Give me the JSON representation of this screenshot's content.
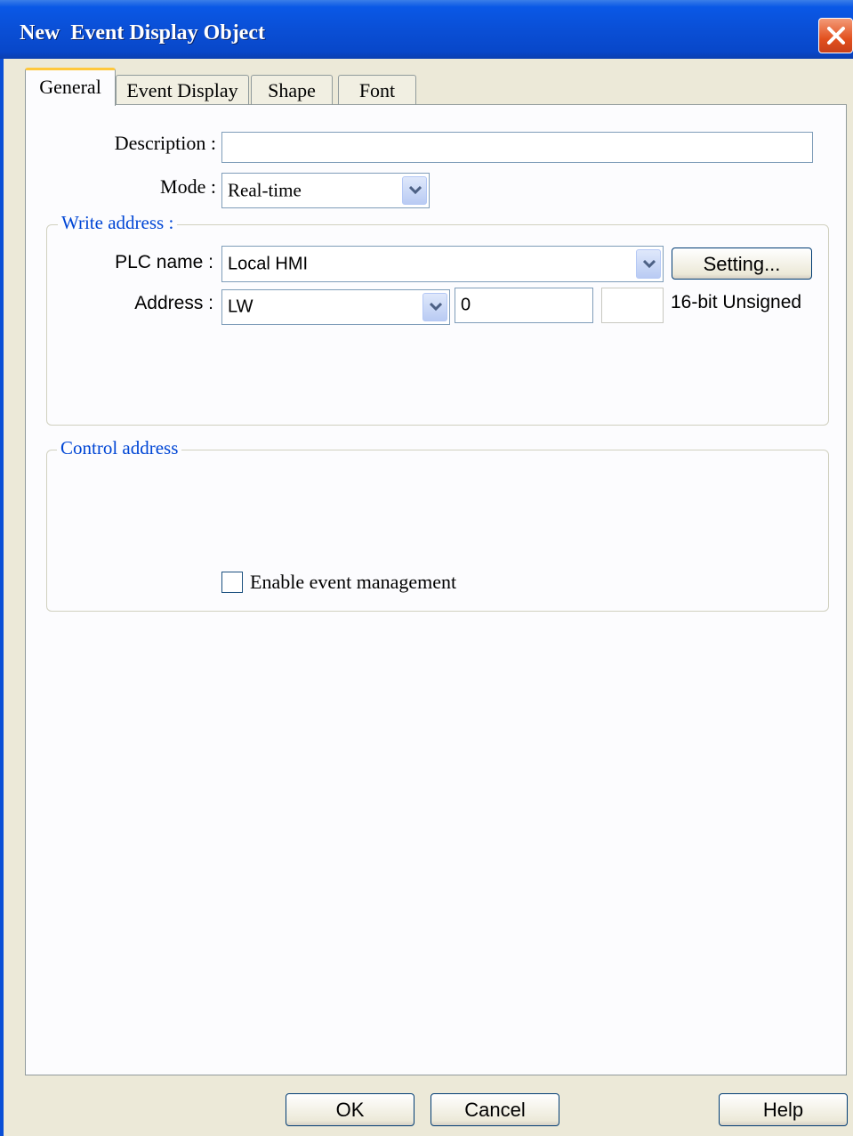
{
  "window": {
    "title": "New  Event Display Object"
  },
  "tabs": [
    {
      "label": "General",
      "active": true
    },
    {
      "label": "Event Display",
      "active": false
    },
    {
      "label": "Shape",
      "active": false
    },
    {
      "label": "Font",
      "active": false
    }
  ],
  "general": {
    "description_label": "Description :",
    "description_value": "",
    "mode_label": "Mode :",
    "mode_value": "Real-time"
  },
  "write_address": {
    "legend": "Write address :",
    "plc_label": "PLC name :",
    "plc_value": "Local HMI",
    "setting_button": "Setting...",
    "address_label": "Address :",
    "address_device": "LW",
    "address_value": "0",
    "address_extra": "",
    "data_format": "16-bit Unsigned"
  },
  "control_address": {
    "legend": "Control address",
    "checkbox_label": "Enable event management",
    "checked": false
  },
  "footer": {
    "ok_label": "OK",
    "cancel_label": "Cancel",
    "help_label": "Help"
  },
  "colors": {
    "title_bar": "#0a4fd6",
    "close_button": "#e2501e",
    "legend_text": "#0046d5",
    "active_tab_accent": "#ffc83c"
  }
}
